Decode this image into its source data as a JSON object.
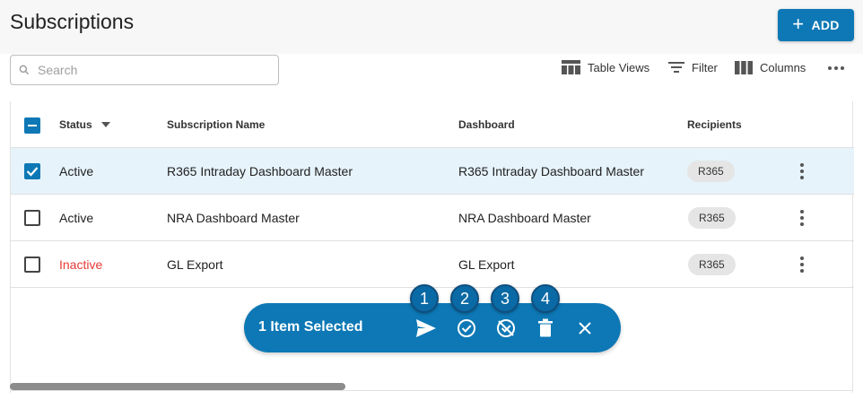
{
  "header": {
    "title": "Subscriptions",
    "add_label": "ADD"
  },
  "search": {
    "placeholder": "Search",
    "value": ""
  },
  "toolbar": {
    "table_views_label": "Table Views",
    "filter_label": "Filter",
    "columns_label": "Columns"
  },
  "table": {
    "columns": [
      "Status",
      "Subscription Name",
      "Dashboard",
      "Recipients"
    ],
    "sort": {
      "column": "Status",
      "direction": "desc"
    },
    "rows": [
      {
        "status": "Active",
        "name": "R365 Intraday Dashboard Master",
        "dashboard": "R365 Intraday Dashboard Master",
        "recipient": "R365",
        "selected": true
      },
      {
        "status": "Active",
        "name": "NRA Dashboard Master",
        "dashboard": "NRA Dashboard Master",
        "recipient": "R365",
        "selected": false
      },
      {
        "status": "Inactive",
        "name": "GL Export",
        "dashboard": "GL Export",
        "recipient": "R365",
        "selected": false
      }
    ]
  },
  "selection_bar": {
    "label": "1 Item Selected",
    "actions": [
      "send-icon",
      "check-circle-icon",
      "disable-icon",
      "trash-icon",
      "close-icon"
    ]
  },
  "badges": [
    "1",
    "2",
    "3",
    "4"
  ],
  "colors": {
    "primary": "#0d78b5",
    "inactive": "#e53935",
    "selected_row": "#e6f3fb",
    "chip": "#e5e5e5"
  },
  "scroll": {
    "position": 0.0,
    "visible_fraction": 0.4
  }
}
